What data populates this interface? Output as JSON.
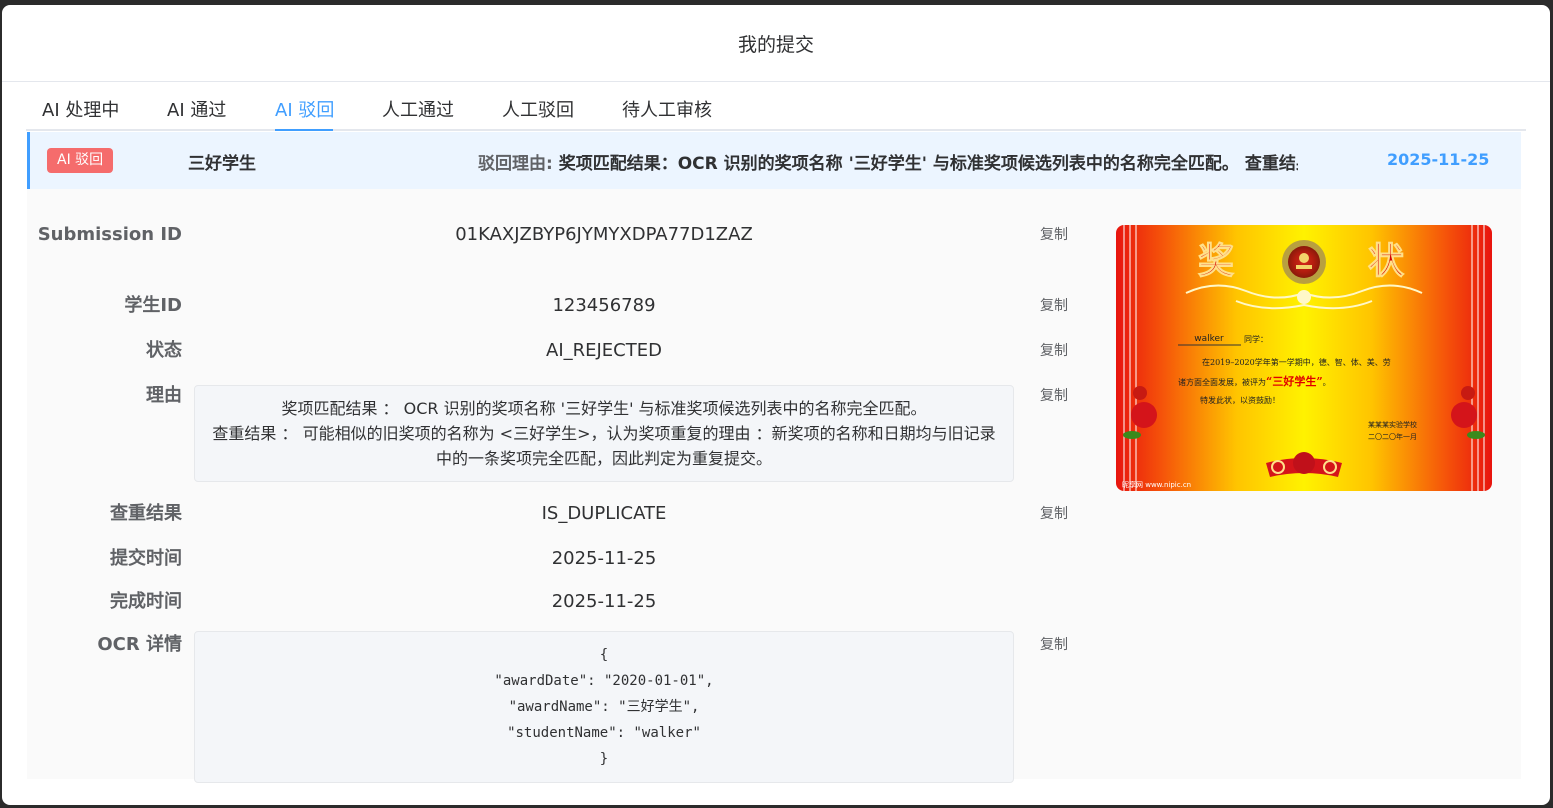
{
  "modal": {
    "title": "我的提交"
  },
  "tabs": [
    {
      "label": "AI 处理中"
    },
    {
      "label": "AI 通过"
    },
    {
      "label": "AI 驳回"
    },
    {
      "label": "人工通过"
    },
    {
      "label": "人工驳回"
    },
    {
      "label": "待人工审核"
    }
  ],
  "active_tab": "AI 驳回",
  "item": {
    "badge": "AI 驳回",
    "title": "三好学生",
    "reason_label": "驳回理由:",
    "reason_text": "奖项匹配结果：OCR 识别的奖项名称 '三好学生' 与标准奖项候选列表中的名称完全匹配。 查重结果",
    "date": "2025-11-25"
  },
  "detail": {
    "copy_label": "复制",
    "submission_id": {
      "label": "Submission ID",
      "value": "01KAXJZBYP6JYMYXDPA77D1ZAZ"
    },
    "student_id": {
      "label": "学生ID",
      "value": "123456789"
    },
    "status": {
      "label": "状态",
      "value": "AI_REJECTED"
    },
    "reason": {
      "label": "理由",
      "lines": [
        "奖项匹配结果 ： OCR 识别的奖项名称 '三好学生' 与标准奖项候选列表中的名称完全匹配。",
        "查重结果 ： 可能相似的旧奖项的名称为 <三好学生>，认为奖项重复的理由 ：新奖项的名称和日期均与旧记录",
        "中的一条奖项完全匹配，因此判定为重复提交。"
      ]
    },
    "dup": {
      "label": "查重结果",
      "value": "IS_DUPLICATE"
    },
    "submit_time": {
      "label": "提交时间",
      "value": "2025-11-25"
    },
    "finish_time": {
      "label": "完成时间",
      "value": "2025-11-25"
    },
    "ocr": {
      "label": "OCR 详情",
      "lines": [
        "{",
        "\"awardDate\": \"2020-01-01\",",
        "\"awardName\": \"三好学生\",",
        "\"studentName\": \"walker\"",
        "}"
      ]
    }
  },
  "certificate": {
    "heading_left": "奖",
    "heading_right": "状",
    "name": "walker",
    "salutation": "同学：",
    "line1": "在2019–2020学年第一学期中，德、智、体、美、劳",
    "line2_prefix": "诸方面全面发展，被评为",
    "honor": "“三好学生”",
    "line2_suffix": "。",
    "line3": "特发此状，以资鼓励！",
    "school": "某某某实验学校",
    "date": "二〇二〇年一月",
    "watermark": "昵享网 www.nipic.cn",
    "colors": {
      "edge": "#e8140e",
      "center": "#fff200",
      "title": "#d40000",
      "gold": "#f3d46a"
    }
  }
}
